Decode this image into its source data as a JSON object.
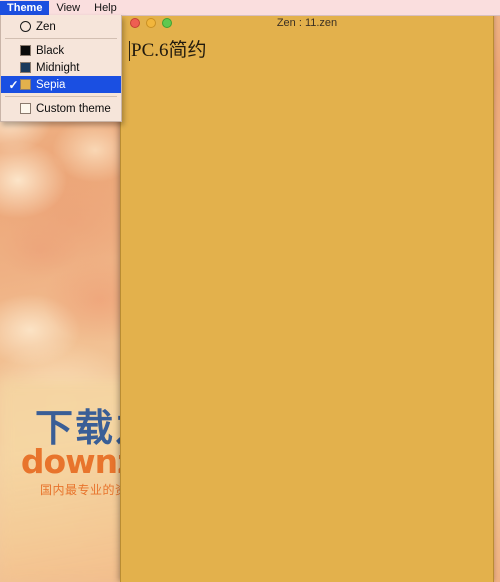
{
  "menubar": {
    "items": [
      {
        "label": "Theme",
        "active": true
      },
      {
        "label": "View",
        "active": false
      },
      {
        "label": "Help",
        "active": false
      }
    ]
  },
  "theme_menu": {
    "items": [
      {
        "label": "Zen",
        "swatch": "ring",
        "swatch_color": "",
        "checked": false,
        "selected": false,
        "check_glyph": "✓"
      },
      {
        "label": "Black",
        "swatch": "square",
        "swatch_color": "#0A0A0A",
        "checked": false,
        "selected": false,
        "check_glyph": "✓"
      },
      {
        "label": "Midnight",
        "swatch": "square",
        "swatch_color": "#1B3A5C",
        "checked": false,
        "selected": false,
        "check_glyph": "✓"
      },
      {
        "label": "Sepia",
        "swatch": "square",
        "swatch_color": "#E3B14C",
        "checked": true,
        "selected": true,
        "check_glyph": "✓"
      },
      {
        "label": "Custom theme",
        "swatch": "square",
        "swatch_color": "#FDF8EE",
        "checked": false,
        "selected": false,
        "check_glyph": "✓"
      }
    ]
  },
  "window": {
    "title": "Zen : 11.zen",
    "traffic_lights": {
      "close": "close-button",
      "minimize": "minimize-button",
      "zoom": "zoom-button"
    },
    "document": {
      "text": "PC.6简约"
    }
  },
  "watermark": {
    "line1": "下载之家",
    "line2": "downza.cn",
    "line3": "国内最专业的资源下载站！"
  },
  "colors": {
    "menubar_bg": "#FADEDE",
    "menu_bg": "#F6E5DA",
    "menu_highlight": "#1A4FE2",
    "editor_bg": "#E3B14C",
    "watermark_blue": "#3A5E96",
    "watermark_orange": "#E8742C"
  }
}
